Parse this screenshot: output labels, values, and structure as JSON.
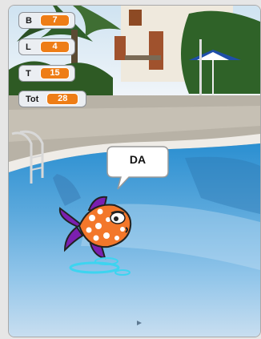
{
  "stage": {
    "background": "swimming-pool-photo",
    "colors": {
      "water": "#4f9fd6",
      "pool_edge": "#e9e6e0",
      "sky_reflection": "#b9dcf4"
    }
  },
  "monitors": [
    {
      "label": "B",
      "value": "7"
    },
    {
      "label": "L",
      "value": "4"
    },
    {
      "label": "T",
      "value": "15"
    },
    {
      "label": "Tot",
      "value": "28"
    }
  ],
  "sprite": {
    "name_icon": "fish-icon",
    "speech": "DA",
    "colors": {
      "body": "#f3772a",
      "spots": "#ffffff",
      "fins": "#7b1fb0",
      "ripples": "#3dd4f0"
    }
  }
}
